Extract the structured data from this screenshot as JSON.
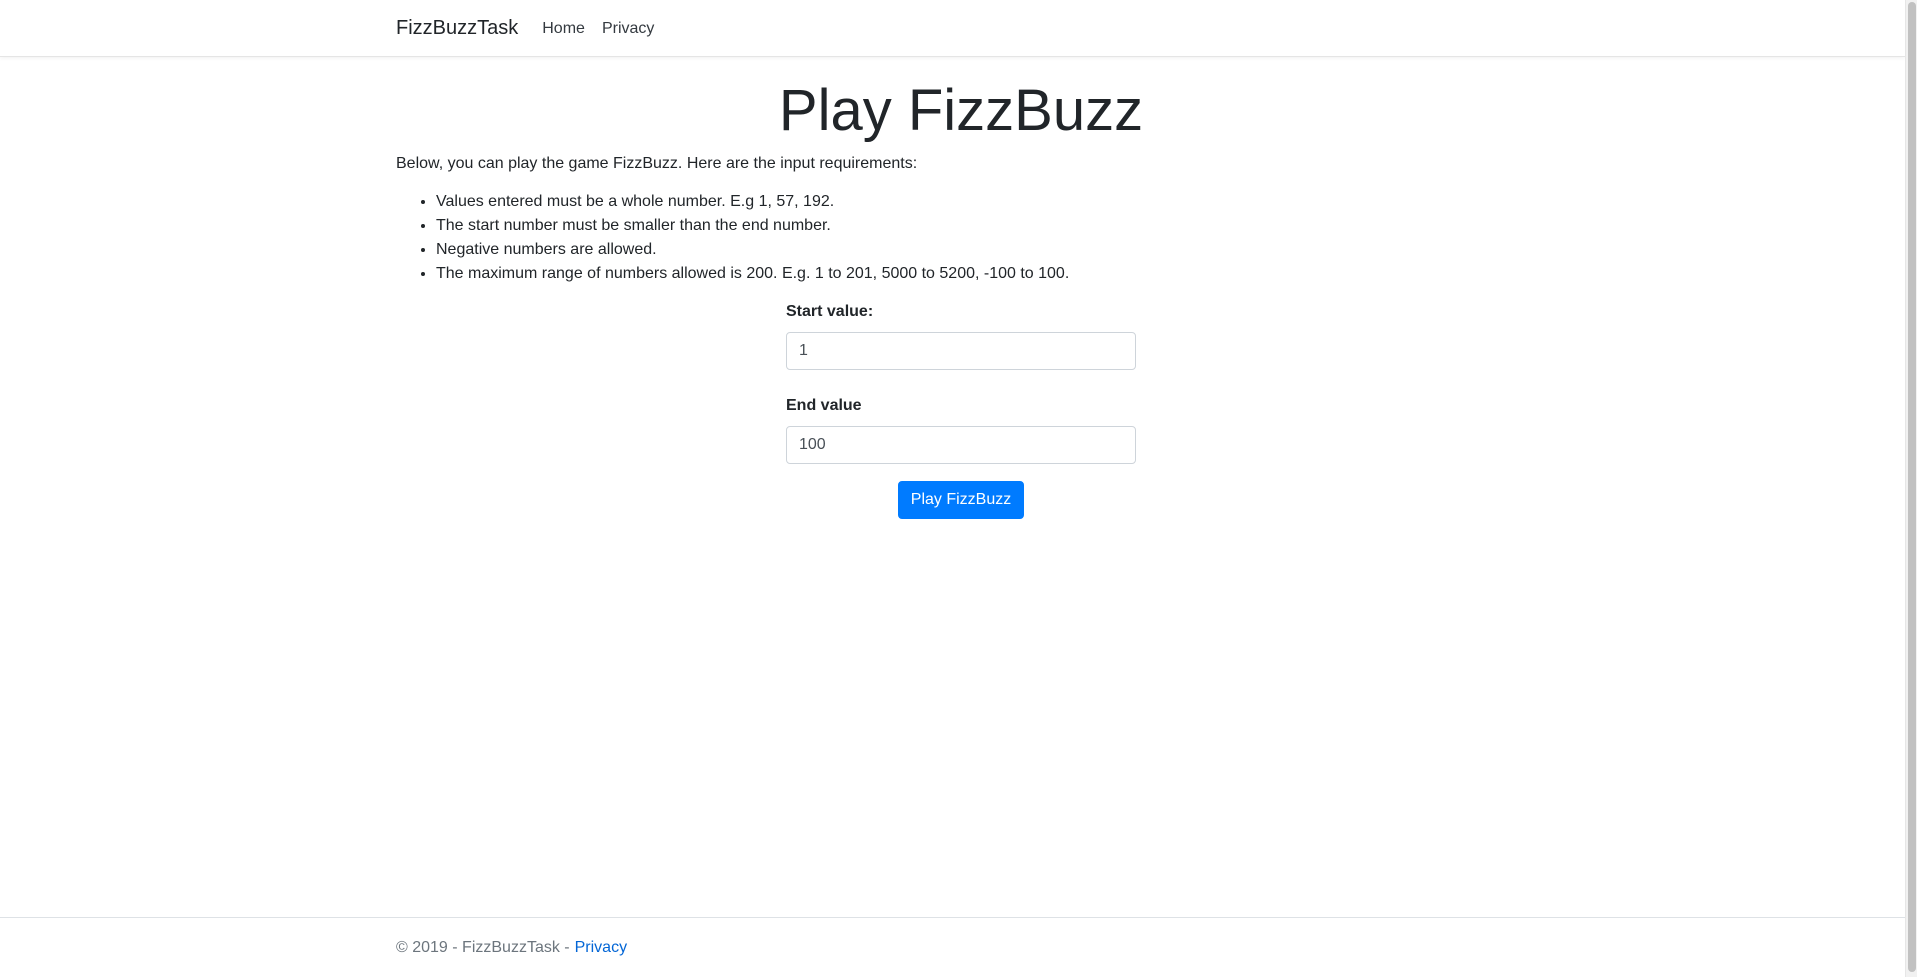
{
  "navbar": {
    "brand": "FizzBuzzTask",
    "links": [
      "Home",
      "Privacy"
    ]
  },
  "main": {
    "title": "Play FizzBuzz",
    "intro": "Below, you can play the game FizzBuzz. Here are the input requirements:",
    "requirements": [
      "Values entered must be a whole number. E.g 1, 57, 192.",
      "The start number must be smaller than the end number.",
      "Negative numbers are allowed.",
      "The maximum range of numbers allowed is 200. E.g. 1 to 201, 5000 to 5200, -100 to 100."
    ],
    "form": {
      "start_label": "Start value:",
      "start_value": "1",
      "end_label": "End value",
      "end_value": "100",
      "submit_label": "Play FizzBuzz"
    }
  },
  "footer": {
    "copyright": "© 2019 - FizzBuzzTask -",
    "privacy_link": "Privacy"
  },
  "colors": {
    "primary": "#007bff",
    "link": "#0366d6",
    "text": "#212529",
    "muted": "#6c757d"
  }
}
